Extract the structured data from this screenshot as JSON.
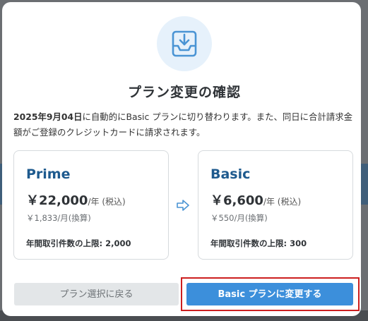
{
  "dialog": {
    "title": "プラン変更の確認",
    "description": {
      "date": "2025年9月04日",
      "text": "に自動的にBasic プランに切り替わります。また、同日に合計請求金額がご登録のクレジットカードに請求されます。"
    },
    "current_plan": {
      "name": "Prime",
      "price": "￥22,000",
      "price_unit": "/年 (税込)",
      "monthly": "￥1,833/月(換算)",
      "limit": "年間取引件数の上限: 2,000"
    },
    "new_plan": {
      "name": "Basic",
      "price": "￥6,600",
      "price_unit": "/年 (税込)",
      "monthly": "￥550/月(換算)",
      "limit": "年間取引件数の上限: 300"
    },
    "buttons": {
      "back": "プラン選択に戻る",
      "confirm": "Basic プランに変更する"
    }
  },
  "colors": {
    "accent": "#3c8fdb",
    "plan_name": "#1e5a8e",
    "highlight_border": "#cc1f1f",
    "overlay": "#4d5054"
  },
  "icons": {
    "hero": "download-tray-icon",
    "transition": "arrow-right-icon"
  }
}
